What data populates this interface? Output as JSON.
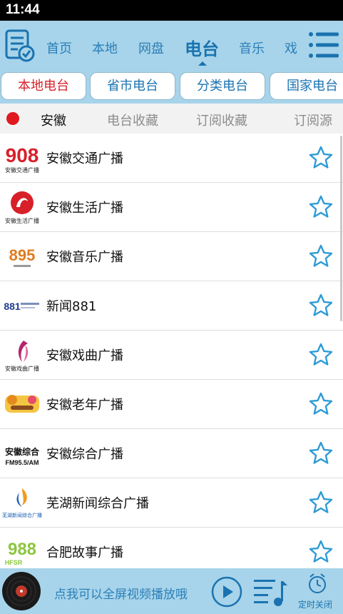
{
  "status_bar": {
    "time": "11:44"
  },
  "top_nav": {
    "tabs": [
      {
        "label": "首页",
        "active": false
      },
      {
        "label": "本地",
        "active": false
      },
      {
        "label": "网盘",
        "active": false
      },
      {
        "label": "电台",
        "active": true
      },
      {
        "label": "音乐",
        "active": false
      },
      {
        "label": "戏",
        "active": false
      }
    ],
    "menu_icon": "hamburger-menu-icon",
    "logo_icon": "checklist-document-icon"
  },
  "sub_tabs": [
    {
      "label": "本地电台",
      "active": true
    },
    {
      "label": "省市电台",
      "active": false
    },
    {
      "label": "分类电台",
      "active": false
    },
    {
      "label": "国家电台",
      "active": false
    }
  ],
  "category_row": {
    "region": "安徽",
    "items": [
      "电台收藏",
      "订阅收藏",
      "订阅源"
    ]
  },
  "stations": [
    {
      "name": "安徽交通广播",
      "logo_text": "908",
      "logo_sub": "安徽交通广播",
      "logo_color": "#d7202a"
    },
    {
      "name": "安徽生活广播",
      "logo_text": "",
      "logo_sub": "安徽生活广播",
      "logo_color": "#d7202a"
    },
    {
      "name": "安徽音乐广播",
      "logo_text": "895",
      "logo_sub": "",
      "logo_color": "#e07a1f"
    },
    {
      "name": "新闻881",
      "logo_text": "881",
      "logo_sub": "",
      "logo_color": "#1e3d8f"
    },
    {
      "name": "安徽戏曲广播",
      "logo_text": "",
      "logo_sub": "安徽戏曲广播",
      "logo_color": "#b5246e"
    },
    {
      "name": "安徽老年广播",
      "logo_text": "",
      "logo_sub": "",
      "logo_color": "#e58a1f"
    },
    {
      "name": "安徽综合广播",
      "logo_text": "安徽综合",
      "logo_sub": "FM95.5/AM",
      "logo_color": "#111111"
    },
    {
      "name": "芜湖新闻综合广播",
      "logo_text": "",
      "logo_sub": "芜湖新闻综合广播",
      "logo_color": "#1a5fb4"
    },
    {
      "name": "合肥故事广播",
      "logo_text": "988",
      "logo_sub": "HFSR",
      "logo_color": "#8cc63f"
    }
  ],
  "player": {
    "hint": "点我可以全屏视频播放哦",
    "timer_label": "定时关闭"
  },
  "colors": {
    "accent_bar": "#a7d4ea",
    "nav_text": "#2c7fb8",
    "active_red": "#d7202a",
    "star_blue": "#2e9bd6"
  }
}
